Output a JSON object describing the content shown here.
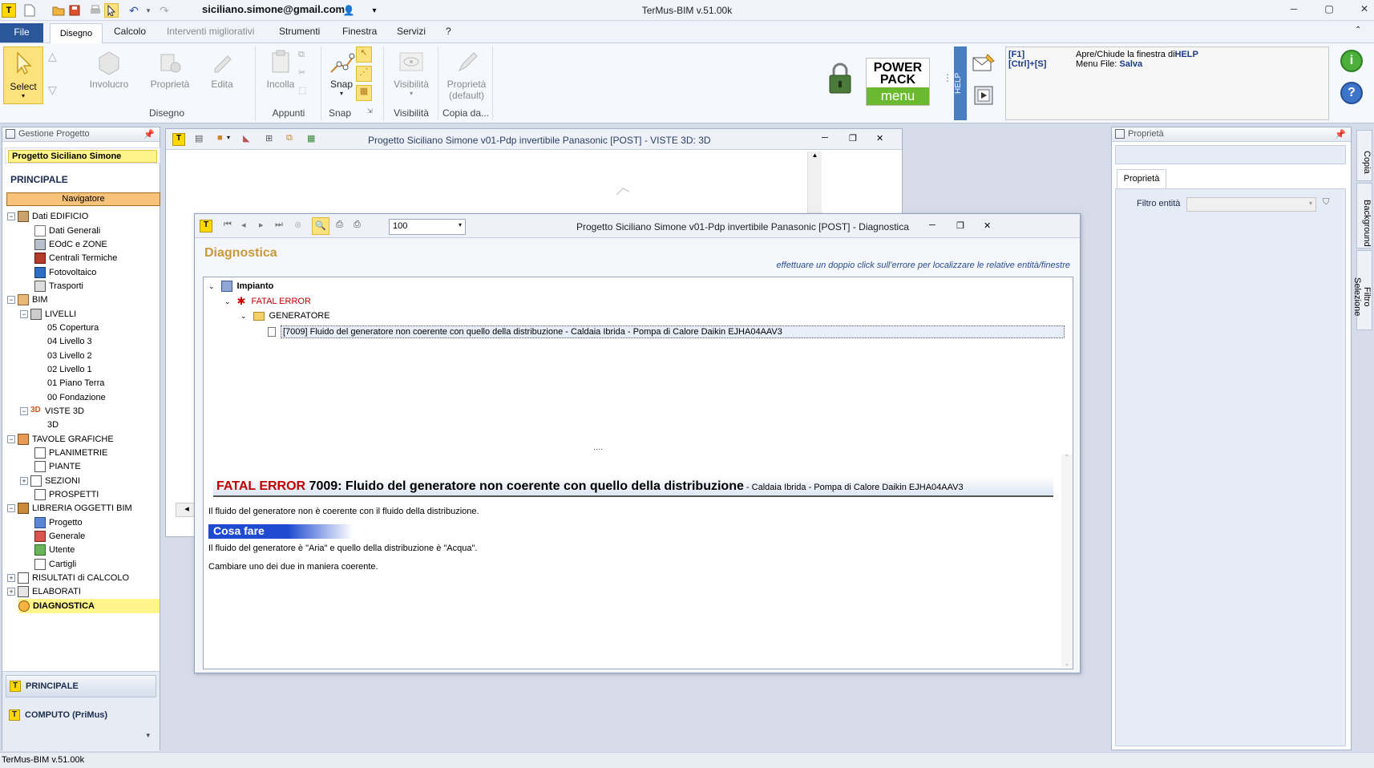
{
  "titlebar": {
    "user": "siciliano.simone@gmail.com",
    "app_title": "TerMus-BIM v.51.00k"
  },
  "menu": {
    "file": "File",
    "tabs": [
      "Disegno",
      "Calcolo",
      "Interventi migliorativi",
      "Strumenti",
      "Finestra",
      "Servizi",
      "?"
    ]
  },
  "ribbon": {
    "select": "Select",
    "buttons": {
      "involucro": "Involucro",
      "proprieta": "Proprietà",
      "edita": "Edita",
      "incolla": "Incolla",
      "snap": "Snap",
      "visibilita": "Visibilità",
      "proprieta_default": "Proprietà (default)"
    },
    "groups": {
      "disegno": "Disegno",
      "appunti": "Appunti",
      "snap": "Snap",
      "visibilita": "Visibilità",
      "copia": "Copia da..."
    },
    "powerpack": {
      "line1": "POWER",
      "line2": "PACK",
      "line3": "menu"
    },
    "help_tab": "HELP",
    "help": {
      "k1": "[F1]",
      "d1a": "Apre/Chiude la finestra di ",
      "d1b": "HELP",
      "k2": "[Ctrl]+[S]",
      "d2a": "Menu File: ",
      "d2b": "Salva"
    }
  },
  "left": {
    "header": "Gestione Progetto",
    "project": "Progetto Siciliano Simone",
    "section": "PRINCIPALE",
    "navigator": "Navigatore",
    "tree": {
      "dati": "Dati EDIFICIO",
      "dati_gen": "Dati Generali",
      "eodc": "EOdC e ZONE",
      "centrali": "Centrali Termiche",
      "fotovoltaico": "Fotovoltaico",
      "trasporti": "Trasporti",
      "bim": "BIM",
      "livelli": "LIVELLI",
      "l05": "05 Copertura",
      "l04": "04 Livello 3",
      "l03": "03 Livello 2",
      "l02": "02 Livello 1",
      "l01": "01 Piano Terra",
      "l00": "00 Fondazione",
      "viste": "VISTE 3D",
      "v3d": "3D",
      "tavole": "TAVOLE GRAFICHE",
      "planimetrie": "PLANIMETRIE",
      "piante": "PIANTE",
      "sezioni": "SEZIONI",
      "prospetti": "PROSPETTI",
      "libreria": "LIBRERIA OGGETTI BIM",
      "progetto": "Progetto",
      "generale": "Generale",
      "utente": "Utente",
      "cartigli": "Cartigli",
      "risultati": "RISULTATI di CALCOLO",
      "elaborati": "ELABORATI",
      "diagnostica": "DIAGNOSTICA"
    },
    "bottom": {
      "principale": "PRINCIPALE",
      "computo": "COMPUTO (PriMus)"
    }
  },
  "win3d": {
    "title": "Progetto Siciliano Simone v01-Pdp invertibile Panasonic [POST] -  VISTE 3D: 3D"
  },
  "diag": {
    "title": "Progetto Siciliano Simone v01-Pdp invertibile Panasonic [POST] - Diagnostica",
    "zoom": "100",
    "heading": "Diagnostica",
    "hint": "effettuare un doppio click sull'errore per localizzare le relative entità/finestre",
    "impianto": "Impianto",
    "fatal": "FATAL ERROR",
    "generatore": "GENERATORE",
    "error_item": "[7009] Fluido del generatore non coerente con quello della distribuzione - Caldaia Ibrida - Pompa di Calore Daikin EJHA04AAV3",
    "splitter": "....",
    "detail_fatal": "FATAL ERROR",
    "detail_title": " 7009: Fluido del generatore non coerente con quello della distribuzione",
    "detail_sub": " - Caldaia Ibrida - Pompa di Calore Daikin EJHA04AAV3",
    "desc": "Il fluido del generatore non è coerente con il fluido della distribuzione.",
    "cosa_fare": "Cosa fare",
    "cause": "Il fluido del generatore è \"Aria\" e quello della distribuzione è \"Acqua\".",
    "fix": "Cambiare uno dei due in maniera coerente."
  },
  "right": {
    "header": "Proprietà",
    "tab": "Proprietà",
    "filter_label": "Filtro entità",
    "side_tabs": [
      "Copia",
      "Background",
      "Filtro Selezione"
    ]
  },
  "status": "TerMus-BIM v.51.00k",
  "colors": {
    "accent": "#2b579a",
    "selection": "#fff58a",
    "fatal": "#c00000",
    "heading": "#c99a3c"
  }
}
